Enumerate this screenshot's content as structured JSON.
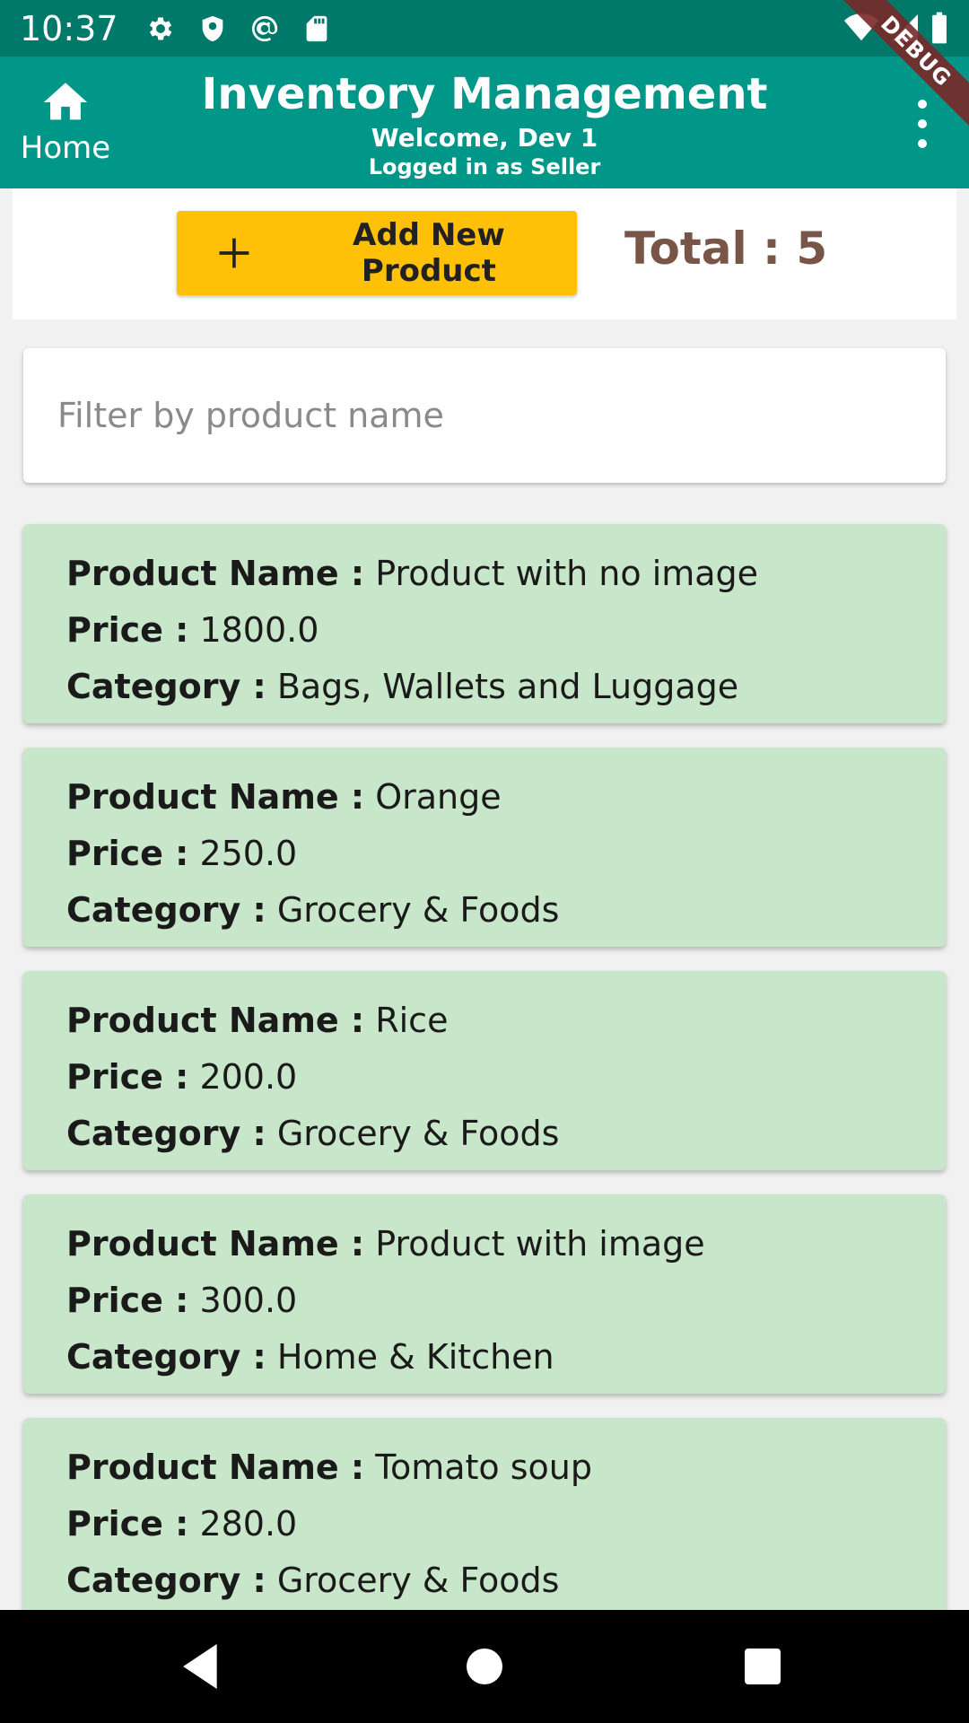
{
  "status_bar": {
    "time": "10:37",
    "left_icons": [
      "gear-icon",
      "shield-icon",
      "at-sign-icon",
      "sd-card-icon"
    ],
    "right_icons": [
      "wifi-icon",
      "signal-icon",
      "battery-icon"
    ]
  },
  "debug_banner": "DEBUG",
  "app_bar": {
    "home_label": "Home",
    "title": "Inventory Management",
    "welcome": "Welcome, Dev 1",
    "role": "Logged in as Seller",
    "background": "#009688",
    "status_bar_color": "#00796b"
  },
  "actions": {
    "add_label": "Add New Product",
    "add_button_color": "#ffc107",
    "total": "Total : 5",
    "total_color": "#795548"
  },
  "filter": {
    "placeholder": "Filter by product name",
    "value": ""
  },
  "labels": {
    "name": "Product Name :",
    "price": "Price :",
    "category": "Category :"
  },
  "card_color": "#c8e6c9",
  "products": [
    {
      "name": "Product with no image",
      "price": "1800.0",
      "category": "Bags, Wallets and Luggage"
    },
    {
      "name": "Orange",
      "price": "250.0",
      "category": "Grocery & Foods"
    },
    {
      "name": "Rice",
      "price": "200.0",
      "category": "Grocery & Foods"
    },
    {
      "name": "Product with image",
      "price": "300.0",
      "category": "Home & Kitchen"
    },
    {
      "name": "Tomato soup",
      "price": "280.0",
      "category": "Grocery & Foods"
    }
  ],
  "nav_icons": [
    "back-icon",
    "home-circle-icon",
    "recents-icon"
  ]
}
